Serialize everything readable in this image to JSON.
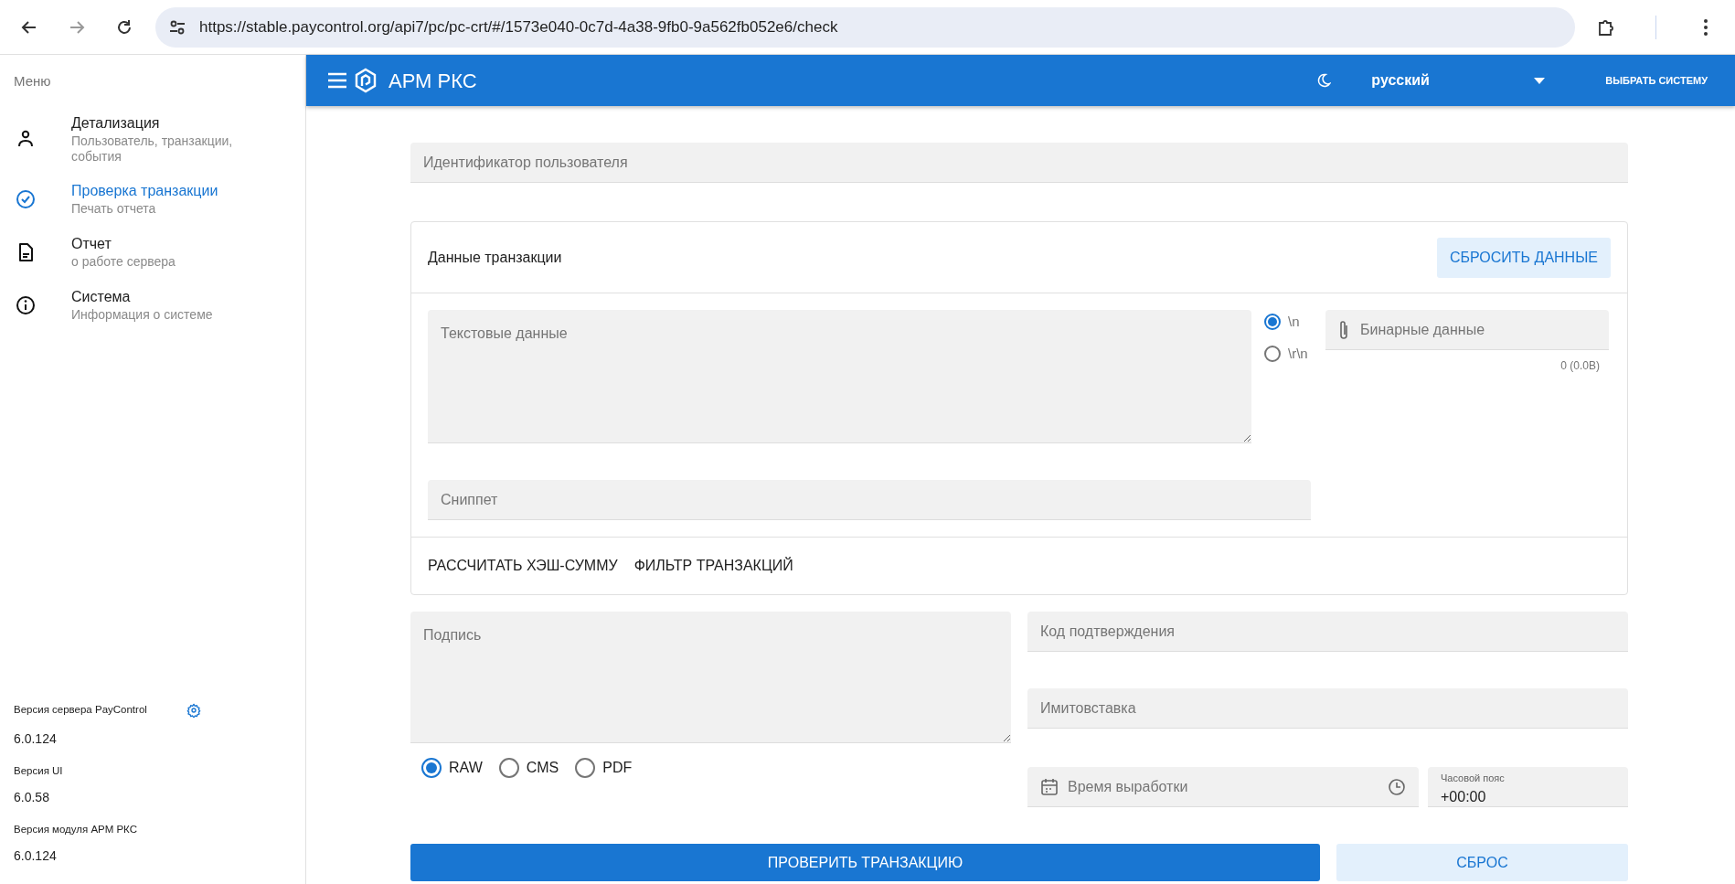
{
  "browser": {
    "url": "https://stable.paycontrol.org/api7/pc/pc-crt/#/1573e040-0c7d-4a38-9fb0-9a562fb052e6/check"
  },
  "sidebar": {
    "title": "Меню",
    "items": [
      {
        "kind": "person",
        "title": "Детализация",
        "subtitle": "Пользователь, транзакции, события",
        "selected": false
      },
      {
        "kind": "check",
        "title": "Проверка транзакции",
        "subtitle": "Печать отчета",
        "selected": true
      },
      {
        "kind": "document",
        "title": "Отчет",
        "subtitle": "о работе сервера",
        "selected": false
      },
      {
        "kind": "info",
        "title": "Система",
        "subtitle": "Информация о системе",
        "selected": false
      }
    ],
    "versions": [
      {
        "label": "Версия сервера PayControl",
        "value": "6.0.124",
        "settings": true
      },
      {
        "label": "Версия UI",
        "value": "6.0.58",
        "settings": false
      },
      {
        "label": "Версия модуля АРМ РКС",
        "value": "6.0.124",
        "settings": false
      }
    ]
  },
  "header": {
    "title": "АРМ РКС",
    "language": "русский",
    "select_system": "ВЫБРАТЬ СИСТЕМУ"
  },
  "form": {
    "user_id": {
      "placeholder": "Идентификатор пользователя"
    },
    "transaction": {
      "title": "Данные транзакции",
      "reset_button": "СБРОСИТЬ ДАННЫЕ",
      "text_data": {
        "placeholder": "Текстовые данные"
      },
      "line_endings": [
        {
          "label": "\\n",
          "selected": true
        },
        {
          "label": "\\r\\n",
          "selected": false
        }
      ],
      "binary_data": {
        "placeholder": "Бинарные данные"
      },
      "binary_size": "0 (0.0B)",
      "snippet": {
        "placeholder": "Сниппет"
      },
      "actions": [
        "РАССЧИТАТЬ ХЭШ-СУММУ",
        "ФИЛЬТР ТРАНЗАКЦИЙ"
      ]
    },
    "signature": {
      "placeholder": "Подпись"
    },
    "formats": [
      {
        "label": "RAW",
        "selected": true
      },
      {
        "label": "CMS",
        "selected": false
      },
      {
        "label": "PDF",
        "selected": false
      }
    ],
    "confirmation_code": {
      "placeholder": "Код подтверждения"
    },
    "mac": {
      "placeholder": "Имитовставка"
    },
    "generation_time": {
      "placeholder": "Время выработки"
    },
    "timezone": {
      "label": "Часовой пояс",
      "value": "+00:00"
    },
    "verify_button": "ПРОВЕРИТЬ ТРАНЗАКЦИЮ",
    "reset_button": "СБРОС"
  }
}
